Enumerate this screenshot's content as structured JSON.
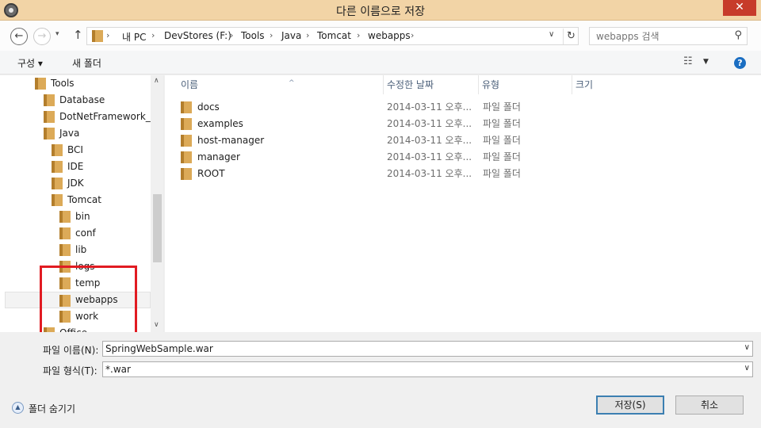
{
  "window": {
    "title": "다른 이름으로 저장",
    "close_symbol": "✕"
  },
  "nav": {
    "back": "←",
    "forward": "→",
    "recent": "▾",
    "up": "↑",
    "breadcrumbs": [
      "내 PC",
      "DevStores (F:)",
      "Tools",
      "Java",
      "Tomcat",
      "webapps"
    ],
    "separator": "›",
    "address_dropdown": "∨",
    "refresh": "↻",
    "search_placeholder": "webapps 검색"
  },
  "toolbar": {
    "organize": "구성 ▾",
    "new_folder": "새 폴더",
    "view_symbol": "☷",
    "view_dropdown": "▼",
    "help": "?"
  },
  "tree": {
    "items": [
      {
        "label": "Tools"
      },
      {
        "label": "Database"
      },
      {
        "label": "DotNetFramework_Di"
      },
      {
        "label": "Java"
      },
      {
        "label": "BCI"
      },
      {
        "label": "IDE"
      },
      {
        "label": "JDK"
      },
      {
        "label": "Tomcat"
      },
      {
        "label": "bin"
      },
      {
        "label": "conf"
      },
      {
        "label": "lib"
      },
      {
        "label": "logs"
      },
      {
        "label": "temp"
      },
      {
        "label": "webapps"
      },
      {
        "label": "work"
      },
      {
        "label": "Office"
      }
    ],
    "scroll_up": "∧",
    "scroll_down": "∨"
  },
  "files": {
    "columns": [
      "이름",
      "수정한 날짜",
      "유형",
      "크기"
    ],
    "sort_arrow": "^",
    "rows": [
      {
        "name": "docs",
        "date": "2014-03-11 오후...",
        "type": "파일 폴더"
      },
      {
        "name": "examples",
        "date": "2014-03-11 오후...",
        "type": "파일 폴더"
      },
      {
        "name": "host-manager",
        "date": "2014-03-11 오후...",
        "type": "파일 폴더"
      },
      {
        "name": "manager",
        "date": "2014-03-11 오후...",
        "type": "파일 폴더"
      },
      {
        "name": "ROOT",
        "date": "2014-03-11 오후...",
        "type": "파일 폴더"
      }
    ]
  },
  "form": {
    "filename_label": "파일 이름(N):",
    "filename_value": "SpringWebSample.war",
    "filetype_label": "파일 형식(T):",
    "filetype_value": "*.war",
    "dropdown": "∨"
  },
  "footer": {
    "hide_folders_icon": "▲",
    "hide_folders": "폴더 숨기기",
    "save": "저장(S)",
    "cancel": "취소"
  }
}
